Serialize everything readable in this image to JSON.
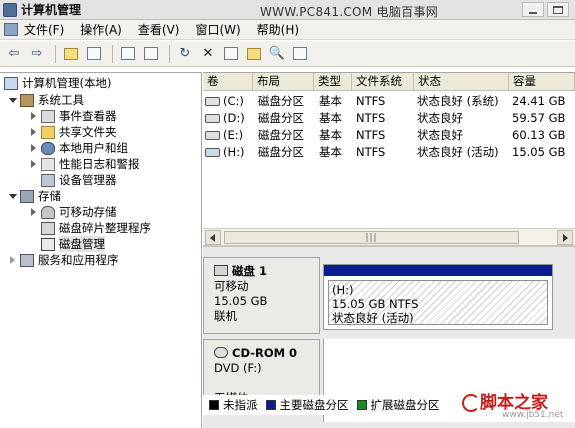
{
  "window": {
    "title": "计算机管理",
    "watermark": "WWW.PC841.COM 电脑百事网"
  },
  "menu": [
    "文件(F)",
    "操作(A)",
    "查看(V)",
    "窗口(W)",
    "帮助(H)"
  ],
  "toolbar": [
    "back-icon",
    "forward-icon",
    "up-folder-icon",
    "show-tree-icon",
    "properties-icon",
    "help-icon",
    "refresh-icon",
    "delete-icon",
    "open-icon",
    "explore-icon",
    "search-icon",
    "disk-icon"
  ],
  "tree": {
    "root": "计算机管理(本地)",
    "system_tools": "系统工具",
    "event_viewer": "事件查看器",
    "shared_folders": "共享文件夹",
    "local_users": "本地用户和组",
    "perf_logs": "性能日志和警报",
    "device_manager": "设备管理器",
    "storage": "存储",
    "removable": "可移动存储",
    "defrag": "磁盘碎片整理程序",
    "disk_mgmt": "磁盘管理",
    "services": "服务和应用程序"
  },
  "columns": [
    "卷",
    "布局",
    "类型",
    "文件系统",
    "状态",
    "容量"
  ],
  "volumes": [
    {
      "vol": "(C:)",
      "layout": "磁盘分区",
      "type": "基本",
      "fs": "NTFS",
      "status": "状态良好 (系统)",
      "size": "24.41 GB"
    },
    {
      "vol": "(D:)",
      "layout": "磁盘分区",
      "type": "基本",
      "fs": "NTFS",
      "status": "状态良好",
      "size": "59.57 GB"
    },
    {
      "vol": "(E:)",
      "layout": "磁盘分区",
      "type": "基本",
      "fs": "NTFS",
      "status": "状态良好",
      "size": "60.13 GB"
    },
    {
      "vol": "(H:)",
      "layout": "磁盘分区",
      "type": "基本",
      "fs": "NTFS",
      "status": "状态良好 (活动)",
      "size": "15.05 GB"
    }
  ],
  "disk1": {
    "title": "磁盘 1",
    "type": "可移动",
    "size": "15.05 GB",
    "status": "联机",
    "partition": {
      "name": "(H:)",
      "desc": "15.05 GB NTFS",
      "status": "状态良好 (活动)"
    }
  },
  "cdrom": {
    "title": "CD-ROM 0",
    "drive": "DVD (F:)",
    "media": "无媒体"
  },
  "legend": [
    {
      "label": "未指派",
      "color": "#000000"
    },
    {
      "label": "主要磁盘分区",
      "color": "#0b1c8c"
    },
    {
      "label": "扩展磁盘分区",
      "color": "#1a8a1a"
    }
  ],
  "corner_watermark": {
    "text": "脚本之家",
    "url": "www.jb51.net"
  }
}
